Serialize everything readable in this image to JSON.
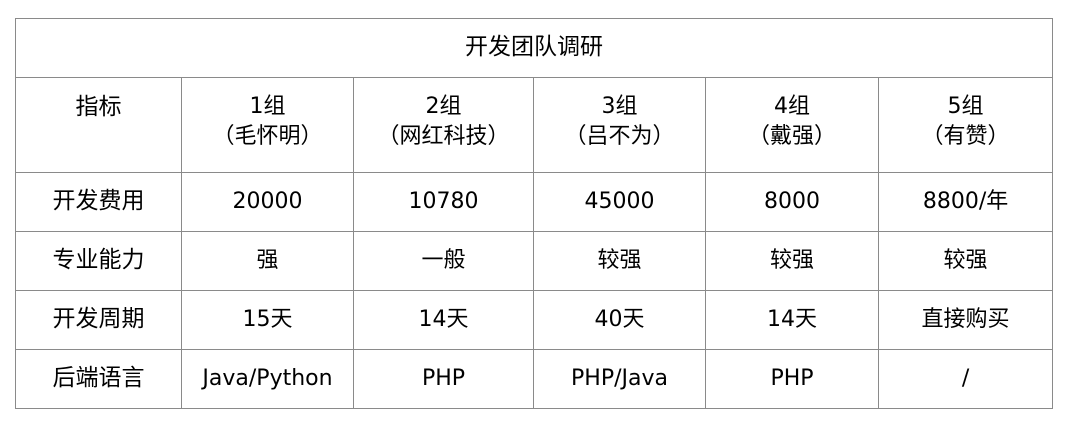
{
  "table": {
    "title": "开发团队调研",
    "corner_label": "指标",
    "columns": [
      {
        "name": "1组",
        "member": "（毛怀明）"
      },
      {
        "name": "2组",
        "member": "（网红科技）"
      },
      {
        "name": "3组",
        "member": "（吕不为）"
      },
      {
        "name": "4组",
        "member": "（戴强）"
      },
      {
        "name": "5组",
        "member": "（有赞）"
      }
    ],
    "rows": [
      {
        "label": "开发费用",
        "values": [
          "20000",
          "10780",
          "45000",
          "8000",
          "8800/年"
        ]
      },
      {
        "label": "专业能力",
        "values": [
          "强",
          "一般",
          "较强",
          "较强",
          "较强"
        ]
      },
      {
        "label": "开发周期",
        "values": [
          "15天",
          "14天",
          "40天",
          "14天",
          "直接购买"
        ]
      },
      {
        "label": "后端语言",
        "values": [
          "Java/Python",
          "PHP",
          "PHP/Java",
          "PHP",
          "/"
        ]
      }
    ]
  }
}
